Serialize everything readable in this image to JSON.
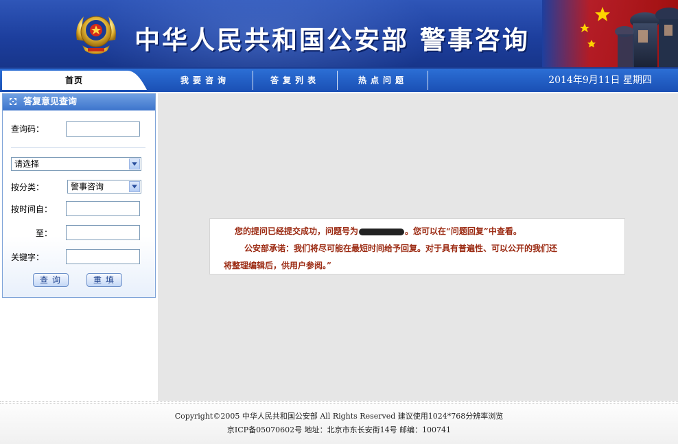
{
  "header": {
    "title": "中华人民共和国公安部 警事咨询",
    "emblem_icon": "police-emblem-icon",
    "flag_icon": "flag-soldiers-image"
  },
  "nav": {
    "items": [
      {
        "label": "首页"
      },
      {
        "label": "我要咨询"
      },
      {
        "label": "答复列表"
      },
      {
        "label": "热点问题"
      }
    ],
    "date": "2014年9月11日 星期四"
  },
  "query_panel": {
    "title": "答复意见查询",
    "code_label": "查询码：",
    "code_value": "",
    "dept_select": "请选择",
    "category_label": "按分类：",
    "category_select": "警事咨询",
    "time_from_label": "按时间自：",
    "time_from_value": "",
    "time_to_label": "至：",
    "time_to_value": "",
    "keyword_label": "关键字：",
    "keyword_value": "",
    "search_button": "查询",
    "reset_button": "重填"
  },
  "message": {
    "line1_prefix": "您的提问已经提交成功，问题号为",
    "line1_suffix": "。您可以在“问题回复”中查看。",
    "line2": "公安部承诺：我们将尽可能在最短时间给予回复。对于具有普遍性、可以公开的我们还",
    "line3": "将整理编辑后，供用户参阅。”"
  },
  "footer": {
    "line1": "Copyright©2005 中华人民共和国公安部  All Rights Reserved 建议使用1024*768分辨率浏览",
    "line2": "京ICP备05070602号     地址：北京市东长安街14号  邮编：100741"
  },
  "colors": {
    "banner": "#1d3f9e",
    "nav": "#1a4fb4",
    "message_text": "#9b2a12",
    "panel_header": "#3d74cc"
  }
}
